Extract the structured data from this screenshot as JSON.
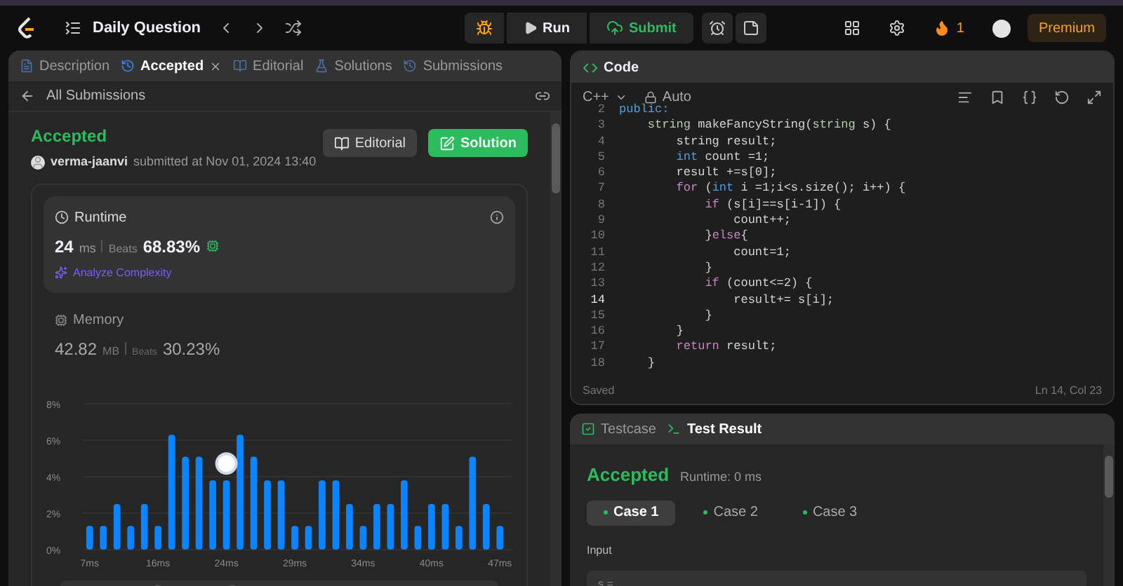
{
  "topbar": {
    "title": "Daily Question",
    "run": "Run",
    "submit": "Submit",
    "streak": "1",
    "premium": "Premium"
  },
  "left_panel": {
    "tabs": [
      {
        "label": "Description",
        "selected": false,
        "closable": false
      },
      {
        "label": "Accepted",
        "selected": true,
        "closable": true
      },
      {
        "label": "Editorial",
        "selected": false,
        "closable": false
      },
      {
        "label": "Solutions",
        "selected": false,
        "closable": false
      },
      {
        "label": "Submissions",
        "selected": false,
        "closable": false
      }
    ],
    "back_link": "All Submissions",
    "submission": {
      "status": "Accepted",
      "user": "verma-jaanvi",
      "submitted": "submitted at Nov 01, 2024 13:40",
      "editorial_button": "Editorial",
      "solution_button": "Solution"
    },
    "runtime": {
      "title": "Runtime",
      "value": "24",
      "unit": "ms",
      "beats_label": "Beats",
      "beats": "68.83%",
      "analyze": "Analyze Complexity"
    },
    "memory": {
      "title": "Memory",
      "value": "42.82",
      "unit": "MB",
      "beats_label": "Beats",
      "beats": "30.23%"
    },
    "chart_data": {
      "type": "bar",
      "values": [
        1.3,
        1.3,
        2.5,
        1.3,
        2.5,
        1.3,
        6.3,
        5.1,
        5.1,
        3.8,
        3.8,
        6.3,
        5.1,
        3.8,
        3.8,
        1.3,
        1.3,
        3.8,
        3.8,
        2.5,
        1.3,
        2.5,
        2.5,
        3.8,
        1.3,
        2.5,
        2.5,
        1.3,
        5.1,
        2.5,
        1.3
      ],
      "ylim": [
        0,
        8
      ],
      "yticks": [
        {
          "value": 0,
          "label": "0%"
        },
        {
          "value": 2,
          "label": "2%"
        },
        {
          "value": 4,
          "label": "4%"
        },
        {
          "value": 6,
          "label": "6%"
        },
        {
          "value": 8,
          "label": "8%"
        }
      ],
      "categories": [
        "7ms",
        null,
        null,
        null,
        null,
        "16ms",
        null,
        null,
        null,
        null,
        "24ms",
        null,
        null,
        null,
        null,
        "29ms",
        null,
        null,
        null,
        null,
        "34ms",
        null,
        null,
        null,
        null,
        "40ms",
        null,
        null,
        null,
        null,
        "47ms"
      ],
      "grid": true,
      "annotations": [
        {
          "x": "24ms"
        }
      ]
    }
  },
  "code_panel": {
    "title": "Code",
    "language": "C++",
    "mode": "Auto",
    "status": "Saved",
    "cursor": "Ln 14, Col 23",
    "lines": [
      {
        "number": "2",
        "current": false,
        "tokens": [
          {
            "text": "public:",
            "kind": "type"
          }
        ]
      },
      {
        "number": "3",
        "current": false,
        "tokens": [
          {
            "text": "    string",
            "kind": "name"
          },
          {
            "text": " makeFancyString(",
            "kind": "plain"
          },
          {
            "text": "string",
            "kind": "name"
          },
          {
            "text": " s) {",
            "kind": "plain"
          }
        ]
      },
      {
        "number": "4",
        "current": false,
        "tokens": [
          {
            "text": "        string result;",
            "kind": "plain"
          }
        ]
      },
      {
        "number": "5",
        "current": false,
        "tokens": [
          {
            "text": "        int",
            "kind": "type"
          },
          {
            "text": " count =1;",
            "kind": "plain"
          }
        ]
      },
      {
        "number": "6",
        "current": false,
        "tokens": [
          {
            "text": "        result +=s[0];",
            "kind": "plain"
          }
        ]
      },
      {
        "number": "7",
        "current": false,
        "tokens": [
          {
            "text": "        for",
            "kind": "keyword"
          },
          {
            "text": " (",
            "kind": "plain"
          },
          {
            "text": "int",
            "kind": "type"
          },
          {
            "text": " i =1;i<s.size(); i++) {",
            "kind": "plain"
          }
        ]
      },
      {
        "number": "8",
        "current": false,
        "tokens": [
          {
            "text": "            if",
            "kind": "keyword"
          },
          {
            "text": " (s[i]==s[i-1]) {",
            "kind": "plain"
          }
        ]
      },
      {
        "number": "9",
        "current": false,
        "tokens": [
          {
            "text": "                count++;",
            "kind": "plain"
          }
        ]
      },
      {
        "number": "10",
        "current": false,
        "tokens": [
          {
            "text": "            }",
            "kind": "plain"
          },
          {
            "text": "else",
            "kind": "keyword"
          },
          {
            "text": "{",
            "kind": "plain"
          }
        ]
      },
      {
        "number": "11",
        "current": false,
        "tokens": [
          {
            "text": "                count=1;",
            "kind": "plain"
          }
        ]
      },
      {
        "number": "12",
        "current": false,
        "tokens": [
          {
            "text": "            }",
            "kind": "plain"
          }
        ]
      },
      {
        "number": "13",
        "current": false,
        "tokens": [
          {
            "text": "            if",
            "kind": "keyword"
          },
          {
            "text": " (count<=2) {",
            "kind": "plain"
          }
        ]
      },
      {
        "number": "14",
        "current": true,
        "tokens": [
          {
            "text": "                result+= s[i];",
            "kind": "plain"
          }
        ]
      },
      {
        "number": "15",
        "current": false,
        "tokens": [
          {
            "text": "            }",
            "kind": "plain"
          }
        ]
      },
      {
        "number": "16",
        "current": false,
        "tokens": [
          {
            "text": "        }",
            "kind": "plain"
          }
        ]
      },
      {
        "number": "17",
        "current": false,
        "tokens": [
          {
            "text": "        return",
            "kind": "keyword"
          },
          {
            "text": " result;",
            "kind": "plain"
          }
        ]
      },
      {
        "number": "18",
        "current": false,
        "tokens": [
          {
            "text": "    }",
            "kind": "plain"
          }
        ]
      }
    ]
  },
  "test_panel": {
    "tabs": [
      {
        "label": "Testcase",
        "selected": false
      },
      {
        "label": "Test Result",
        "selected": true
      }
    ],
    "result": "Accepted",
    "runtime": "Runtime: 0 ms",
    "cases": [
      {
        "label": "Case 1",
        "selected": true,
        "color": "#2cbb5d"
      },
      {
        "label": "Case 2",
        "selected": false,
        "color": "#2cbb5d"
      },
      {
        "label": "Case 3",
        "selected": false,
        "color": "#2cbb5d"
      }
    ],
    "input_label": "Input",
    "input_value": "s ="
  }
}
